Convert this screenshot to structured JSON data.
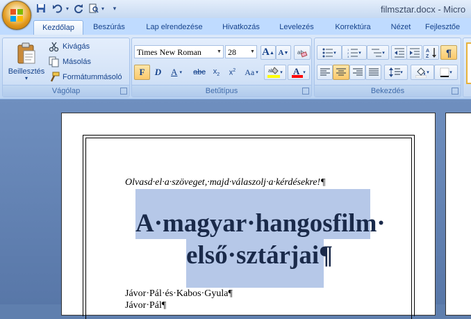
{
  "window": {
    "title": "filmsztar.docx - Micro"
  },
  "tabs": [
    "Kezdőlap",
    "Beszúrás",
    "Lap elrendezése",
    "Hivatkozás",
    "Levelezés",
    "Korrektúra",
    "Nézet",
    "Fejlesztőe"
  ],
  "active_tab": "Kezdőlap",
  "groups": {
    "clipboard": {
      "label": "Vágólap",
      "paste": "Beillesztés",
      "cut": "Kivágás",
      "copy": "Másolás",
      "format_painter": "Formátummásoló"
    },
    "font": {
      "label": "Betűtípus",
      "font_name": "Times New Roman",
      "font_size": "28",
      "bold": "F",
      "italic": "D",
      "underline": "A",
      "strike": "abc",
      "subscript": "x",
      "superscript": "x",
      "change_case": "Aa",
      "grow": "A",
      "shrink": "A",
      "highlight_color": "#ffff00",
      "font_color": "#ff0000"
    },
    "paragraph": {
      "label": "Bekezdés",
      "alignment": "center",
      "show_marks": "¶"
    }
  },
  "document": {
    "instruction": "Olvasd·el·a·szöveget,·majd·válaszolj·a·kérdésekre!¶",
    "title_line1": "A·magyar·hangosfilm·",
    "title_line2": "első·sztárjai¶",
    "body_line1": "Jávor·Pál·és·Kabos·Gyula¶",
    "body_line2": "Jávor·Pál¶"
  },
  "colors": {
    "accent": "#15428b",
    "selection": "#b6c8e8"
  }
}
